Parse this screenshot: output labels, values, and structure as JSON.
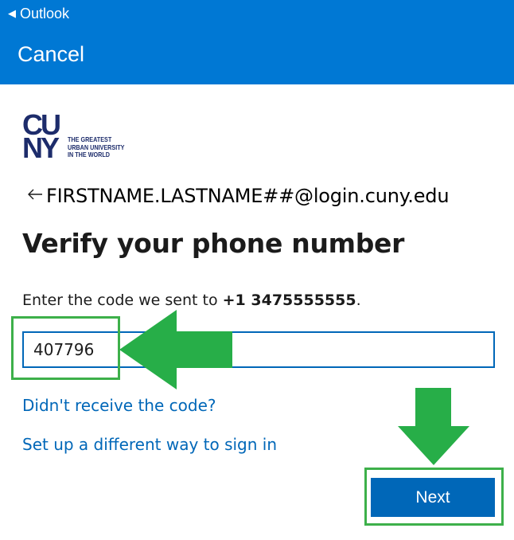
{
  "status_bar": {
    "back_app_label": "Outlook"
  },
  "header": {
    "cancel_label": "Cancel"
  },
  "logo": {
    "line1": "CU",
    "line2": "NY",
    "tagline_1": "THE GREATEST",
    "tagline_2": "URBAN UNIVERSITY",
    "tagline_3": "IN THE WORLD",
    "color": "#1d2c6b"
  },
  "identity": {
    "email": "FIRSTNAME.LASTNAME##@login.cuny.edu"
  },
  "main": {
    "title": "Verify your phone number",
    "instruction_prefix": "Enter the code we sent to ",
    "phone_number": "+1 3475555555",
    "instruction_suffix": ".",
    "code_value": "407796",
    "resend_link": "Didn't receive the code?",
    "other_method_link": "Set up a different way to sign in",
    "next_label": "Next"
  },
  "colors": {
    "header_blue": "#0078d4",
    "button_blue": "#0067b8",
    "link_blue": "#0067b8",
    "annotation_green": "#27ae48"
  },
  "icons": {
    "back_app": "triangle-left-icon",
    "identity_back": "arrow-left-icon"
  }
}
